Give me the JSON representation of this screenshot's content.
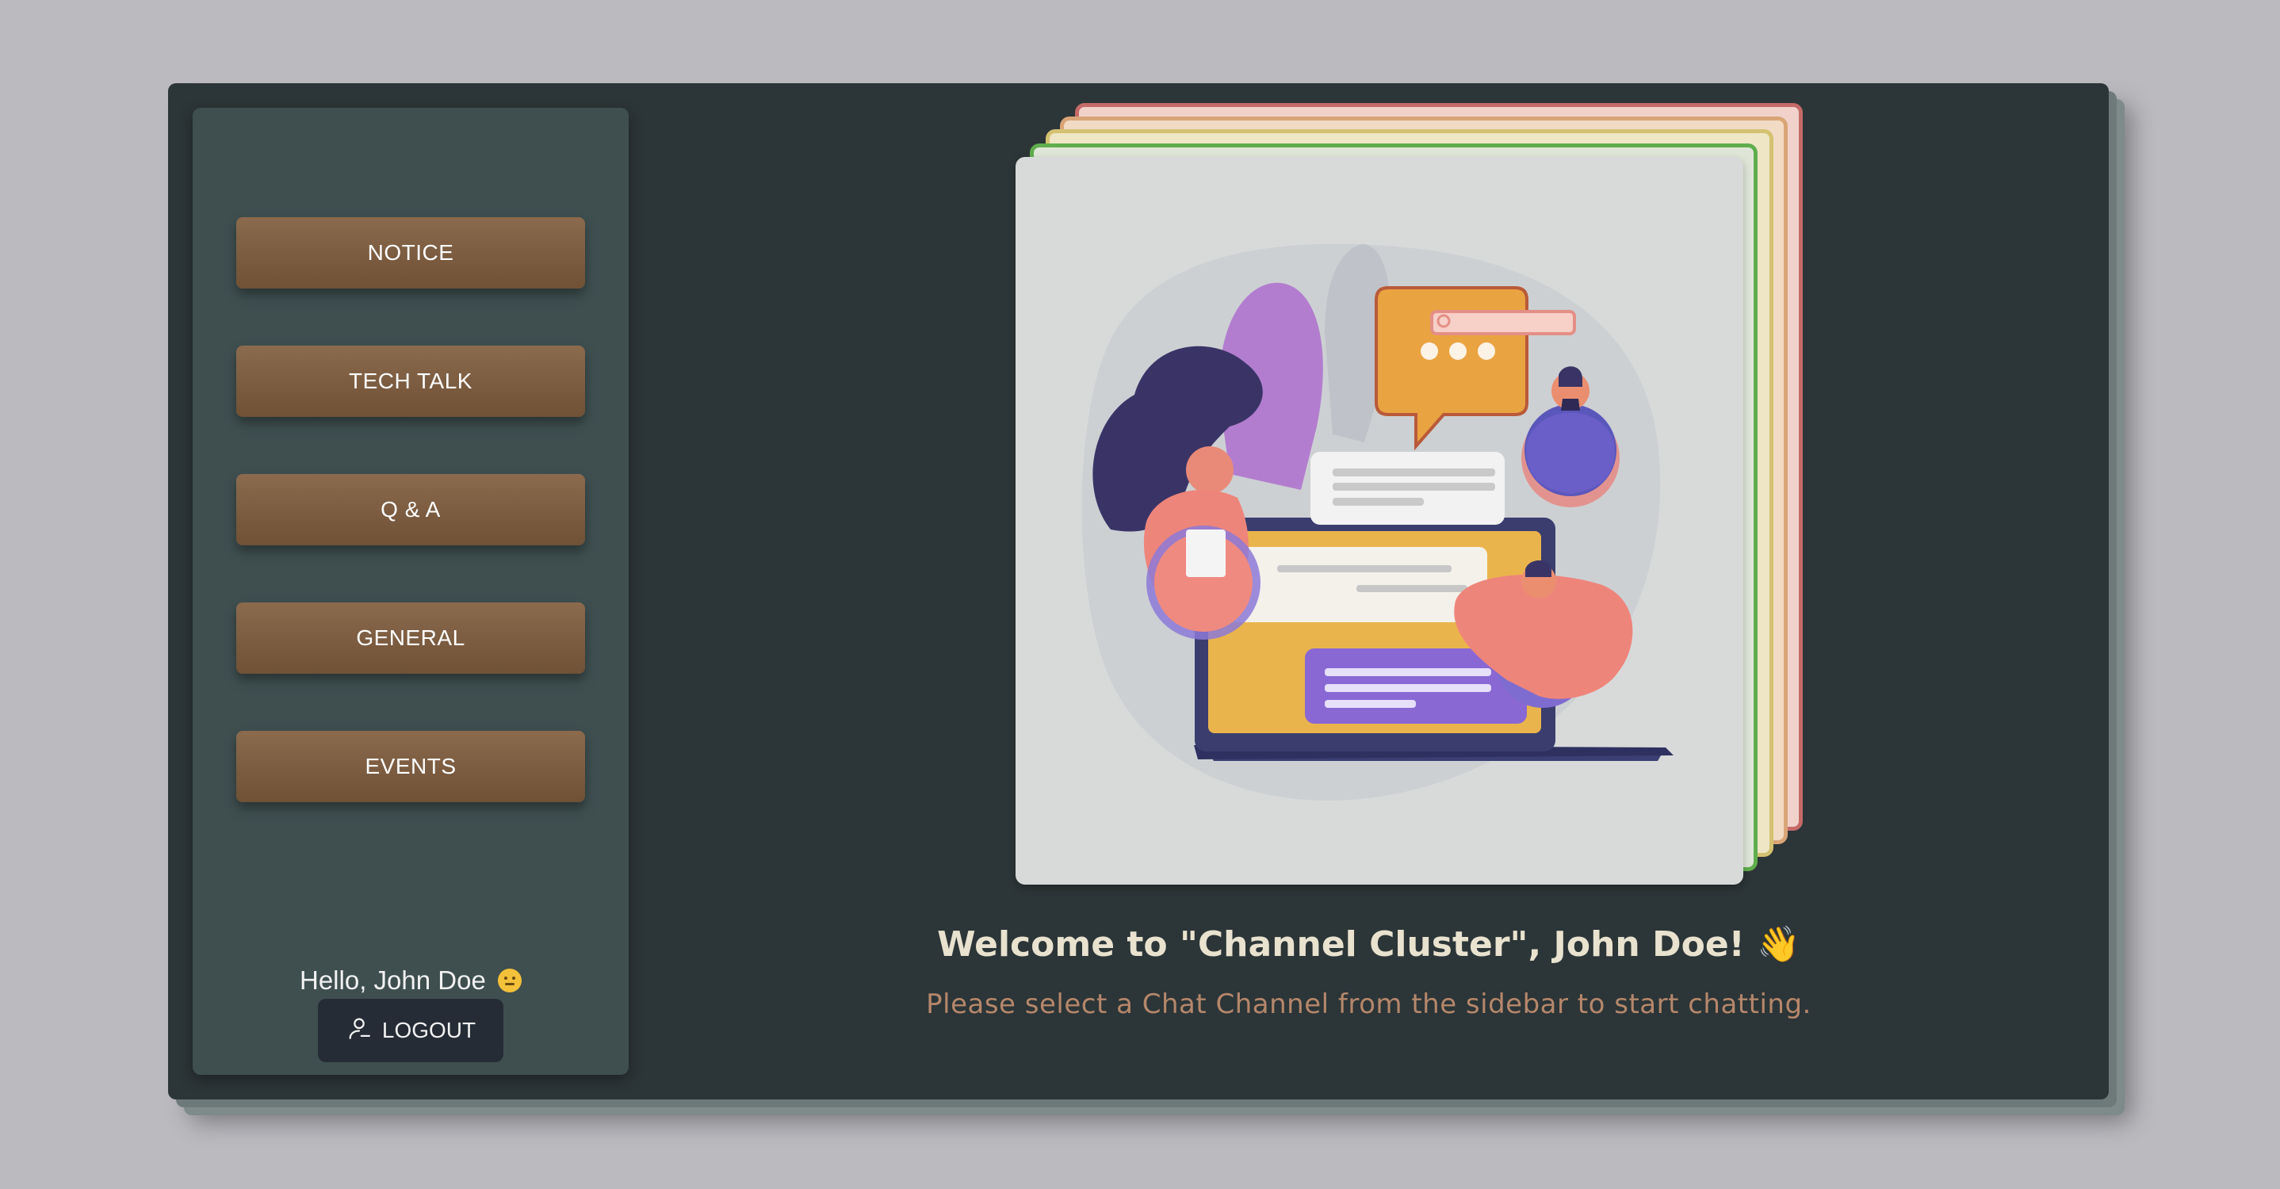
{
  "sidebar": {
    "channels": [
      {
        "label": "NOTICE"
      },
      {
        "label": "TECH TALK"
      },
      {
        "label": "Q & A"
      },
      {
        "label": "GENERAL"
      },
      {
        "label": "EVENTS"
      }
    ],
    "greeting": "Hello, John Doe",
    "greeting_emoji_icon": "slightly-smiling-face-icon",
    "logout_label": "LOGOUT",
    "logout_icon": "user-icon"
  },
  "main": {
    "welcome_title": "Welcome to \"Channel Cluster\", John Doe! 👋",
    "welcome_subtitle": "Please select a Chat Channel from the sidebar to start chatting.",
    "illustration": "chat-illustration"
  },
  "colors": {
    "background": "#bbbabf",
    "panel": "#2c3537",
    "sidebar": "#3f4f50",
    "channel_button": "#7d5e42",
    "logout_button": "#252c36",
    "title_text": "#e8e2cf",
    "subtitle_text": "#b5876b"
  }
}
